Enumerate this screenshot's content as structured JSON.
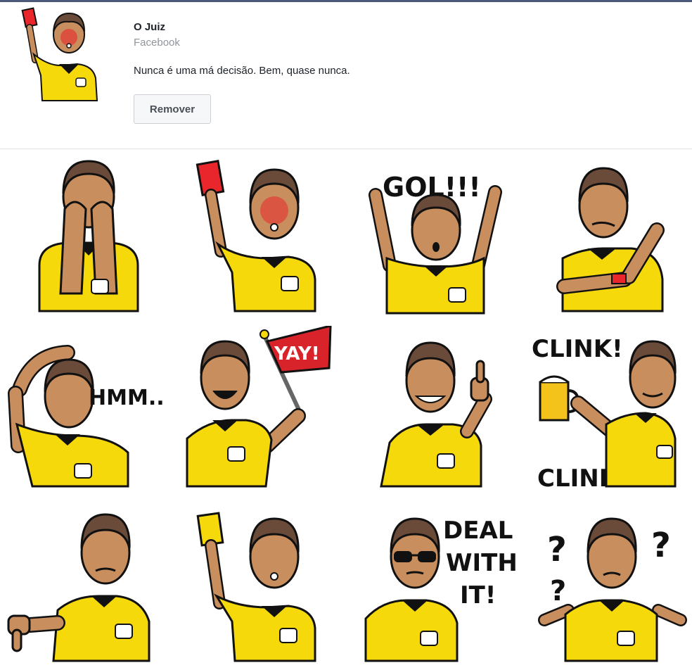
{
  "pack": {
    "title": "O Juiz",
    "source": "Facebook",
    "description": "Nunca é uma má decisão. Bem, quase nunca.",
    "remove_label": "Remover"
  },
  "stickers": [
    {
      "pose": "facepalm",
      "text": []
    },
    {
      "pose": "red-card",
      "text": []
    },
    {
      "pose": "goal-cheer",
      "text": [
        "GOL!!!"
      ]
    },
    {
      "pose": "pointing-watch",
      "text": []
    },
    {
      "pose": "scratching-head",
      "text": [
        "HMM.."
      ]
    },
    {
      "pose": "yay-flag",
      "text": [
        "YAY!"
      ]
    },
    {
      "pose": "thumbs-up",
      "text": []
    },
    {
      "pose": "beer-clink",
      "text": [
        "CLINK!",
        "CLINK!"
      ]
    },
    {
      "pose": "thumbs-down",
      "text": []
    },
    {
      "pose": "yellow-card",
      "text": []
    },
    {
      "pose": "sunglasses",
      "text": [
        "DEAL",
        "WITH",
        "IT!"
      ]
    },
    {
      "pose": "confused",
      "text": [
        "?",
        "?",
        "?"
      ]
    }
  ],
  "colors": {
    "shirt": "#f5d90a",
    "skin": "#c98e5e",
    "hair": "#6a4a38",
    "red_card": "#e8262b",
    "yellow_card": "#f5d90a",
    "flag": "#d8232a",
    "beer": "#f3c21b"
  }
}
